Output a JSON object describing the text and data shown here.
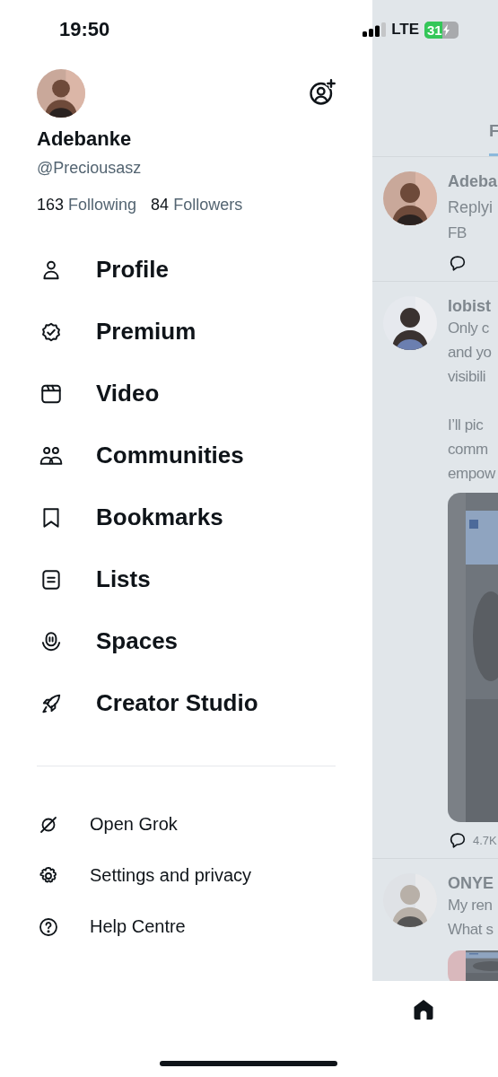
{
  "status_bar": {
    "time": "19:50",
    "network": "LTE",
    "battery": "31"
  },
  "account": {
    "name": "Adebanke",
    "handle": "@Preciousasz",
    "following_count": "163",
    "following_label": "Following",
    "followers_count": "84",
    "followers_label": "Followers"
  },
  "menu": [
    {
      "label": "Profile"
    },
    {
      "label": "Premium"
    },
    {
      "label": "Video"
    },
    {
      "label": "Communities"
    },
    {
      "label": "Bookmarks"
    },
    {
      "label": "Lists"
    },
    {
      "label": "Spaces"
    },
    {
      "label": "Creator Studio"
    }
  ],
  "secondary_menu": [
    {
      "label": "Open Grok"
    },
    {
      "label": "Settings and privacy"
    },
    {
      "label": "Help Centre"
    }
  ],
  "feed": {
    "tabs": [
      {
        "label": "F",
        "selected": true
      }
    ],
    "posts": [
      {
        "author": "Adeba",
        "replying_to": "Replyi",
        "paragraphs": [
          [
            "FB"
          ]
        ],
        "reply_icon": true
      },
      {
        "author": "lobist",
        "paragraphs": [
          [
            "Only c",
            "and yo",
            "visibili"
          ],
          [
            "I’ll pic",
            "comm",
            "empow"
          ]
        ],
        "media": {
          "kind": "picture"
        },
        "reply_icon": true,
        "reply_count": "4.7K"
      },
      {
        "author": "ONYE",
        "paragraphs": [
          [
            "My ren",
            "What s"
          ]
        ],
        "media": {
          "kind": "picture"
        }
      }
    ]
  }
}
